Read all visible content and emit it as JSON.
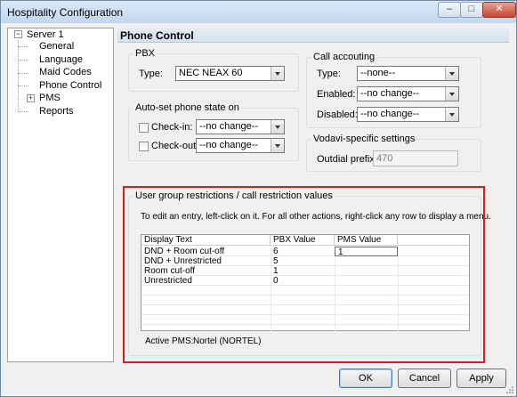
{
  "window": {
    "title": "Hospitality Configuration",
    "min_label": "–",
    "max_label": "□",
    "close_label": "✕"
  },
  "tree": {
    "root": {
      "label": "Server 1",
      "expander": "−"
    },
    "items": [
      {
        "label": "General"
      },
      {
        "label": "Language"
      },
      {
        "label": "Maid Codes"
      },
      {
        "label": "Phone Control",
        "selected": true
      },
      {
        "label": "PMS",
        "expander": "+"
      },
      {
        "label": "Reports"
      }
    ]
  },
  "page": {
    "title": "Phone Control"
  },
  "pbx": {
    "legend": "PBX",
    "type_label": "Type:",
    "type_value": "NEC NEAX 60"
  },
  "auto_set": {
    "legend": "Auto-set phone state on",
    "checkin_label": "Check-in:",
    "checkin_value": "--no change--",
    "checkout_label": "Check-out:",
    "checkout_value": "--no change--"
  },
  "call_accounting": {
    "legend": "Call accouting",
    "type_label": "Type:",
    "type_value": "--none--",
    "enabled_label": "Enabled:",
    "enabled_value": "--no change--",
    "disabled_label": "Disabled:",
    "disabled_value": "--no change--"
  },
  "vodavi": {
    "legend": "Vodavi-specific settings",
    "prefix_label": "Outdial prefix:",
    "prefix_value": "470"
  },
  "user_group": {
    "legend": "User group restrictions / call restriction values",
    "instructions": "To edit an entry, left-click on it.  For all other actions, right-click any row to display a menu.",
    "columns": [
      "Display Text",
      "PBX Value",
      "PMS Value"
    ],
    "rows": [
      {
        "display": "DND + Room cut-off",
        "pbx": "6",
        "pms": "1"
      },
      {
        "display": "DND + Unrestricted",
        "pbx": "5",
        "pms": ""
      },
      {
        "display": "Room cut-off",
        "pbx": "1",
        "pms": ""
      },
      {
        "display": "Unrestricted",
        "pbx": "0",
        "pms": ""
      }
    ],
    "active_pms_label": "Active PMS:",
    "active_pms_value": "Nortel (NORTEL)"
  },
  "buttons": {
    "ok": "OK",
    "cancel": "Cancel",
    "apply": "Apply"
  },
  "colors": {
    "highlight": "#e01b1b",
    "titlebar": "#c2d7ee"
  }
}
